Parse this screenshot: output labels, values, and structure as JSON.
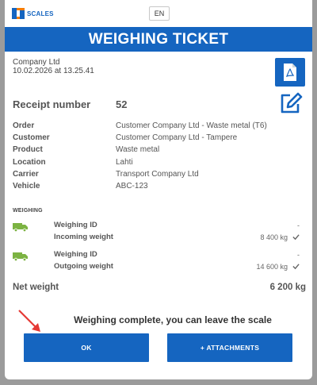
{
  "app": {
    "logo_text": "SCALES",
    "language": "EN"
  },
  "header": {
    "title": "WEIGHING TICKET"
  },
  "ticket": {
    "company": "Company Ltd",
    "datetime": "10.02.2026 at 13.25.41",
    "receipt_label": "Receipt number",
    "receipt_number": "52"
  },
  "details": [
    {
      "label": "Order",
      "value": "Customer Company Ltd - Waste metal (T6)"
    },
    {
      "label": "Customer",
      "value": "Customer Company Ltd - Tampere"
    },
    {
      "label": "Product",
      "value": "Waste metal"
    },
    {
      "label": "Location",
      "value": "Lahti"
    },
    {
      "label": "Carrier",
      "value": "Transport Company Ltd"
    },
    {
      "label": "Vehicle",
      "value": "ABC-123"
    }
  ],
  "weighing": {
    "section_title": "WEIGHING",
    "incoming": {
      "id_label": "Weighing ID",
      "id_value": "-",
      "weight_label": "Incoming weight",
      "weight_value": "8 400 kg"
    },
    "outgoing": {
      "id_label": "Weighing ID",
      "id_value": "-",
      "weight_label": "Outgoing weight",
      "weight_value": "14 600 kg"
    }
  },
  "net": {
    "label": "Net weight",
    "value": "6 200 kg"
  },
  "status_message": "Weighing complete, you can leave the scale",
  "actions": {
    "ok_label": "OK",
    "attachments_label": "+ ATTACHMENTS"
  },
  "colors": {
    "accent": "#1565c0",
    "truck": "#7cb342",
    "arrow": "#e53935"
  },
  "icons": [
    "logo-icon",
    "pdf-icon",
    "edit-icon",
    "truck-icon",
    "check-icon",
    "arrow-icon"
  ]
}
